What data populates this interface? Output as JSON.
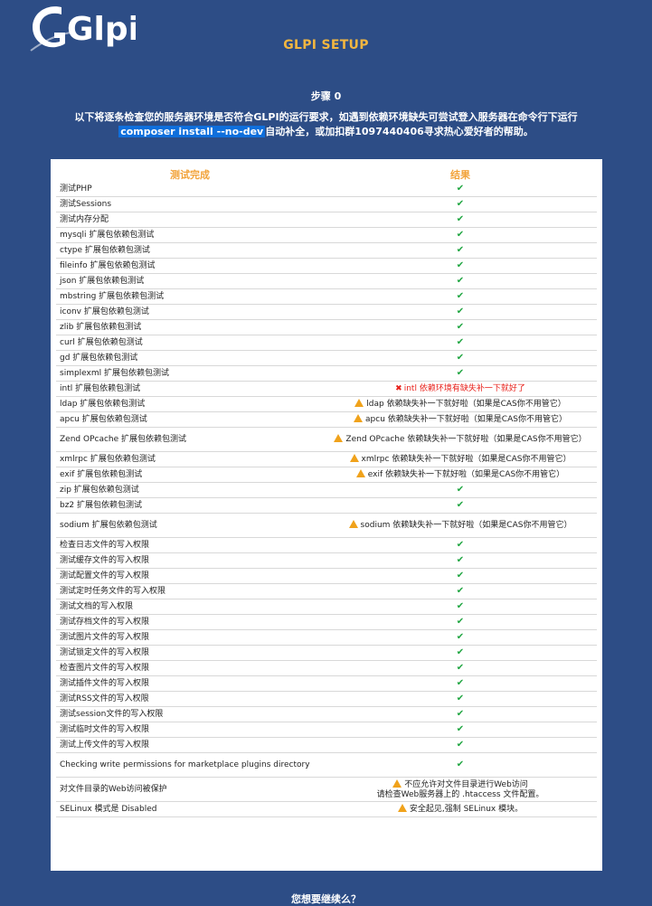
{
  "header": {
    "logo_text": "Glpi",
    "setup_title": "GLPI SETUP",
    "step": "步骤 0",
    "intro_line1": "以下将逐条检查您的服务器环境是否符合GLPI的运行要求，如遇到依赖环境缺失可尝试登入服务器在命令行下运行",
    "intro_cmd": "composer install --no-dev",
    "intro_line2_rest": "自动补全，或加扣群1097440406寻求热心爱好者的帮助。"
  },
  "table": {
    "col_test": "测试完成",
    "col_result": "结果",
    "rows": [
      {
        "test": "测试PHP",
        "status": "ok",
        "msg": "✔"
      },
      {
        "test": "测试Sessions",
        "status": "ok",
        "msg": "✔"
      },
      {
        "test": "测试内存分配",
        "status": "ok",
        "msg": "✔"
      },
      {
        "test": "mysqli 扩展包依赖包测试",
        "status": "ok",
        "msg": "✔"
      },
      {
        "test": "ctype 扩展包依赖包测试",
        "status": "ok",
        "msg": "✔"
      },
      {
        "test": "fileinfo 扩展包依赖包测试",
        "status": "ok",
        "msg": "✔"
      },
      {
        "test": "json 扩展包依赖包测试",
        "status": "ok",
        "msg": "✔"
      },
      {
        "test": "mbstring 扩展包依赖包测试",
        "status": "ok",
        "msg": "✔"
      },
      {
        "test": "iconv 扩展包依赖包测试",
        "status": "ok",
        "msg": "✔"
      },
      {
        "test": "zlib 扩展包依赖包测试",
        "status": "ok",
        "msg": "✔"
      },
      {
        "test": "curl 扩展包依赖包测试",
        "status": "ok",
        "msg": "✔"
      },
      {
        "test": "gd 扩展包依赖包测试",
        "status": "ok",
        "msg": "✔"
      },
      {
        "test": "simplexml 扩展包依赖包测试",
        "status": "ok",
        "msg": "✔"
      },
      {
        "test": "intl 扩展包依赖包测试",
        "status": "error",
        "msg": "intl 依赖环境有缺失补一下就好了"
      },
      {
        "test": "ldap 扩展包依赖包测试",
        "status": "warn",
        "msg": "ldap 依赖缺失补一下就好啦（如果是CAS你不用管它）"
      },
      {
        "test": "apcu 扩展包依赖包测试",
        "status": "warn",
        "msg": "apcu 依赖缺失补一下就好啦（如果是CAS你不用管它）"
      },
      {
        "test": "Zend OPcache 扩展包依赖包测试",
        "status": "warn",
        "msg": "Zend OPcache 依赖缺失补一下就好啦（如果是CAS你不用管它）",
        "tall": true
      },
      {
        "test": "xmlrpc 扩展包依赖包测试",
        "status": "warn",
        "msg": "xmlrpc 依赖缺失补一下就好啦（如果是CAS你不用管它）"
      },
      {
        "test": "exif 扩展包依赖包测试",
        "status": "warn",
        "msg": "exif 依赖缺失补一下就好啦（如果是CAS你不用管它）"
      },
      {
        "test": "zip 扩展包依赖包测试",
        "status": "ok",
        "msg": "✔"
      },
      {
        "test": "bz2 扩展包依赖包测试",
        "status": "ok",
        "msg": "✔"
      },
      {
        "test": "sodium 扩展包依赖包测试",
        "status": "warn",
        "msg": "sodium 依赖缺失补一下就好啦（如果是CAS你不用管它）",
        "tall": true
      },
      {
        "test": "检查日志文件的写入权限",
        "status": "ok",
        "msg": "✔"
      },
      {
        "test": "测试缓存文件的写入权限",
        "status": "ok",
        "msg": "✔"
      },
      {
        "test": "测试配置文件的写入权限",
        "status": "ok",
        "msg": "✔"
      },
      {
        "test": "测试定时任务文件的写入权限",
        "status": "ok",
        "msg": "✔"
      },
      {
        "test": "测试文档的写入权限",
        "status": "ok",
        "msg": "✔"
      },
      {
        "test": "测试存档文件的写入权限",
        "status": "ok",
        "msg": "✔"
      },
      {
        "test": "测试图片文件的写入权限",
        "status": "ok",
        "msg": "✔"
      },
      {
        "test": "测试锁定文件的写入权限",
        "status": "ok",
        "msg": "✔"
      },
      {
        "test": "检查图片文件的写入权限",
        "status": "ok",
        "msg": "✔"
      },
      {
        "test": "测试插件文件的写入权限",
        "status": "ok",
        "msg": "✔"
      },
      {
        "test": "测试RSS文件的写入权限",
        "status": "ok",
        "msg": "✔"
      },
      {
        "test": "测试session文件的写入权限",
        "status": "ok",
        "msg": "✔"
      },
      {
        "test": "测试临时文件的写入权限",
        "status": "ok",
        "msg": "✔"
      },
      {
        "test": "测试上传文件的写入权限",
        "status": "ok",
        "msg": "✔"
      },
      {
        "test": "Checking write permissions for marketplace plugins directory",
        "status": "ok",
        "msg": "✔",
        "tall": true
      },
      {
        "test": "对文件目录的Web访问被保护",
        "status": "warn",
        "msg": "不应允许对文件目录进行Web访问",
        "msg2": "请检查Web服务器上的 .htaccess 文件配置。",
        "tall": true
      },
      {
        "test": "SELinux 模式是 Disabled",
        "status": "warn",
        "msg": "安全起见,强制 SELinux 模块。"
      }
    ]
  },
  "footer": {
    "question": "您想要继续么？"
  },
  "colors": {
    "background": "#2d4d86",
    "accent": "#f2b640",
    "ok": "#21a642",
    "error": "#e8201a",
    "warning": "#f0a21b",
    "command_highlight": "#0f6fdc"
  }
}
